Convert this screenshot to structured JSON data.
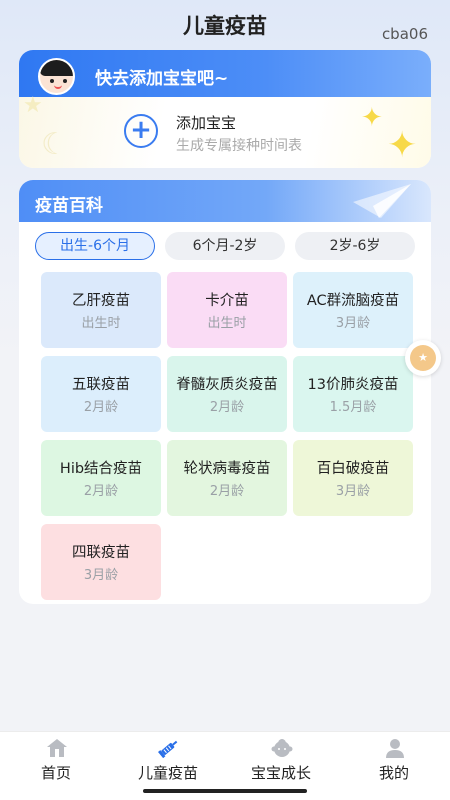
{
  "header": {
    "title": "儿童疫苗",
    "user_id": "cba06"
  },
  "add_baby": {
    "banner_text": "快去添加宝宝吧~",
    "title": "添加宝宝",
    "subtitle": "生成专属接种时间表"
  },
  "encyclopedia": {
    "title": "疫苗百科",
    "tabs": [
      {
        "label": "出生-6个月",
        "active": true
      },
      {
        "label": "6个月-2岁",
        "active": false
      },
      {
        "label": "2岁-6岁",
        "active": false
      }
    ],
    "vaccines": [
      {
        "name": "乙肝疫苗",
        "age": "出生时",
        "color": "#dbe9fb"
      },
      {
        "name": "卡介苗",
        "age": "出生时",
        "color": "#fadcf5"
      },
      {
        "name": "AC群流脑疫苗",
        "age": "3月龄",
        "color": "#ddf1fb"
      },
      {
        "name": "五联疫苗",
        "age": "2月龄",
        "color": "#dceefc"
      },
      {
        "name": "脊髓灰质炎疫苗",
        "age": "2月龄",
        "color": "#d9f5ec"
      },
      {
        "name": "13价肺炎疫苗",
        "age": "1.5月龄",
        "color": "#daf6ef"
      },
      {
        "name": "Hib结合疫苗",
        "age": "2月龄",
        "color": "#ddf7e2"
      },
      {
        "name": "轮状病毒疫苗",
        "age": "2月龄",
        "color": "#e3f6df"
      },
      {
        "name": "百白破疫苗",
        "age": "3月龄",
        "color": "#eef7d8"
      },
      {
        "name": "四联疫苗",
        "age": "3月龄",
        "color": "#fddfe1"
      }
    ]
  },
  "nav": {
    "items": [
      {
        "label": "首页",
        "icon": "home-icon",
        "active": false
      },
      {
        "label": "儿童疫苗",
        "icon": "syringe-icon",
        "active": true
      },
      {
        "label": "宝宝成长",
        "icon": "baby-icon",
        "active": false
      },
      {
        "label": "我的",
        "icon": "person-icon",
        "active": false
      }
    ]
  },
  "colors": {
    "accent": "#2a6fe8",
    "banner": "#3a7cf0",
    "star": "#f7d948"
  }
}
